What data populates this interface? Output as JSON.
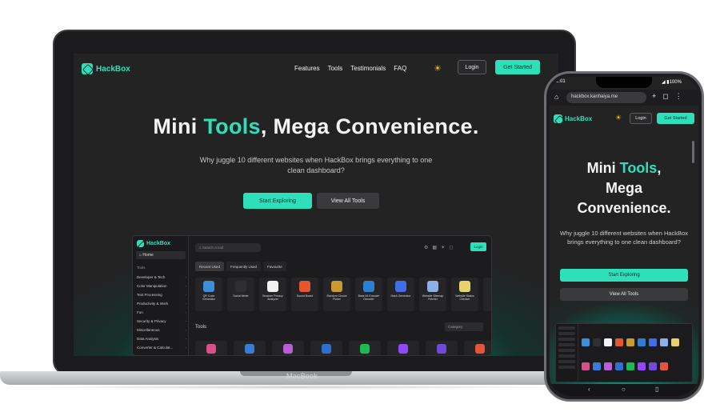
{
  "laptop": {
    "brand": "MacBook",
    "nav": {
      "logo": "HackBox",
      "links": [
        "Features",
        "Tools",
        "Testimonials",
        "FAQ"
      ],
      "theme_icon": "sun-icon",
      "login": "Login",
      "get_started": "Get Started"
    },
    "hero": {
      "title_part1": "Mini ",
      "title_accent": "Tools",
      "title_part2": ", Mega Convenience.",
      "subtitle": "Why juggle 10 different websites when HackBox brings everything to one clean dashboard?",
      "primary_button": "Start Exploring",
      "secondary_button": "View All Tools"
    },
    "dashboard": {
      "logo": "HackBox",
      "home": "Home",
      "tools_caption": "Tools",
      "sidebar": [
        "Developer & Tech",
        "Color Manipulation",
        "Text Processing",
        "Productivity & Work",
        "Fun",
        "Security & Privacy",
        "Miscellaneous",
        "Data Analysis",
        "Converter & Calculat..."
      ],
      "search_placeholder": "Search a tool",
      "login": "Login",
      "tabs": [
        "Recent Used",
        "Frequently Used",
        "Favourite"
      ],
      "cards": [
        {
          "label": "QR Code Generator",
          "color": "#3b8ed8"
        },
        {
          "label": "Social Meter",
          "color": "#2f2f31"
        },
        {
          "label": "Browser Privacy Analyzer",
          "color": "#f2f2f2"
        },
        {
          "label": "Sound Board",
          "color": "#e4572e"
        },
        {
          "label": "Random Choice Picker",
          "color": "#c99a2e"
        },
        {
          "label": "Base 64 Encoder Decoder",
          "color": "#2f7fd1"
        },
        {
          "label": "Hash Generator",
          "color": "#3f6ee8"
        },
        {
          "label": "Website Sitemap Fetcher",
          "color": "#8fb0e6"
        },
        {
          "label": "Website Status Checker",
          "color": "#e8d36a"
        },
        {
          "label": "Ur...",
          "color": "#3a3a3c"
        }
      ],
      "tools_title": "Tools",
      "category_placeholder": "Category",
      "row2_colors": [
        "#d94f8a",
        "#3a7bd5",
        "#b95fd6",
        "#2f6fd0",
        "#1db954",
        "#9146ff",
        "#6f4bd8",
        "#e5533d"
      ]
    }
  },
  "phone": {
    "time": "2:01",
    "battery": "100%",
    "url": "hackbox.kanhaiya.me",
    "nav": {
      "logo": "HackBox",
      "login": "Login",
      "get_started": "Get Started"
    },
    "hero": {
      "line1_part1": "Mini ",
      "line1_accent": "Tools",
      "line1_part2": ",",
      "line2": "Mega",
      "line3": "Convenience.",
      "subtitle": "Why juggle 10 different websites when HackBox brings everything to one clean dashboard?",
      "primary_button": "Start Exploring",
      "secondary_button": "View All Tools"
    }
  }
}
